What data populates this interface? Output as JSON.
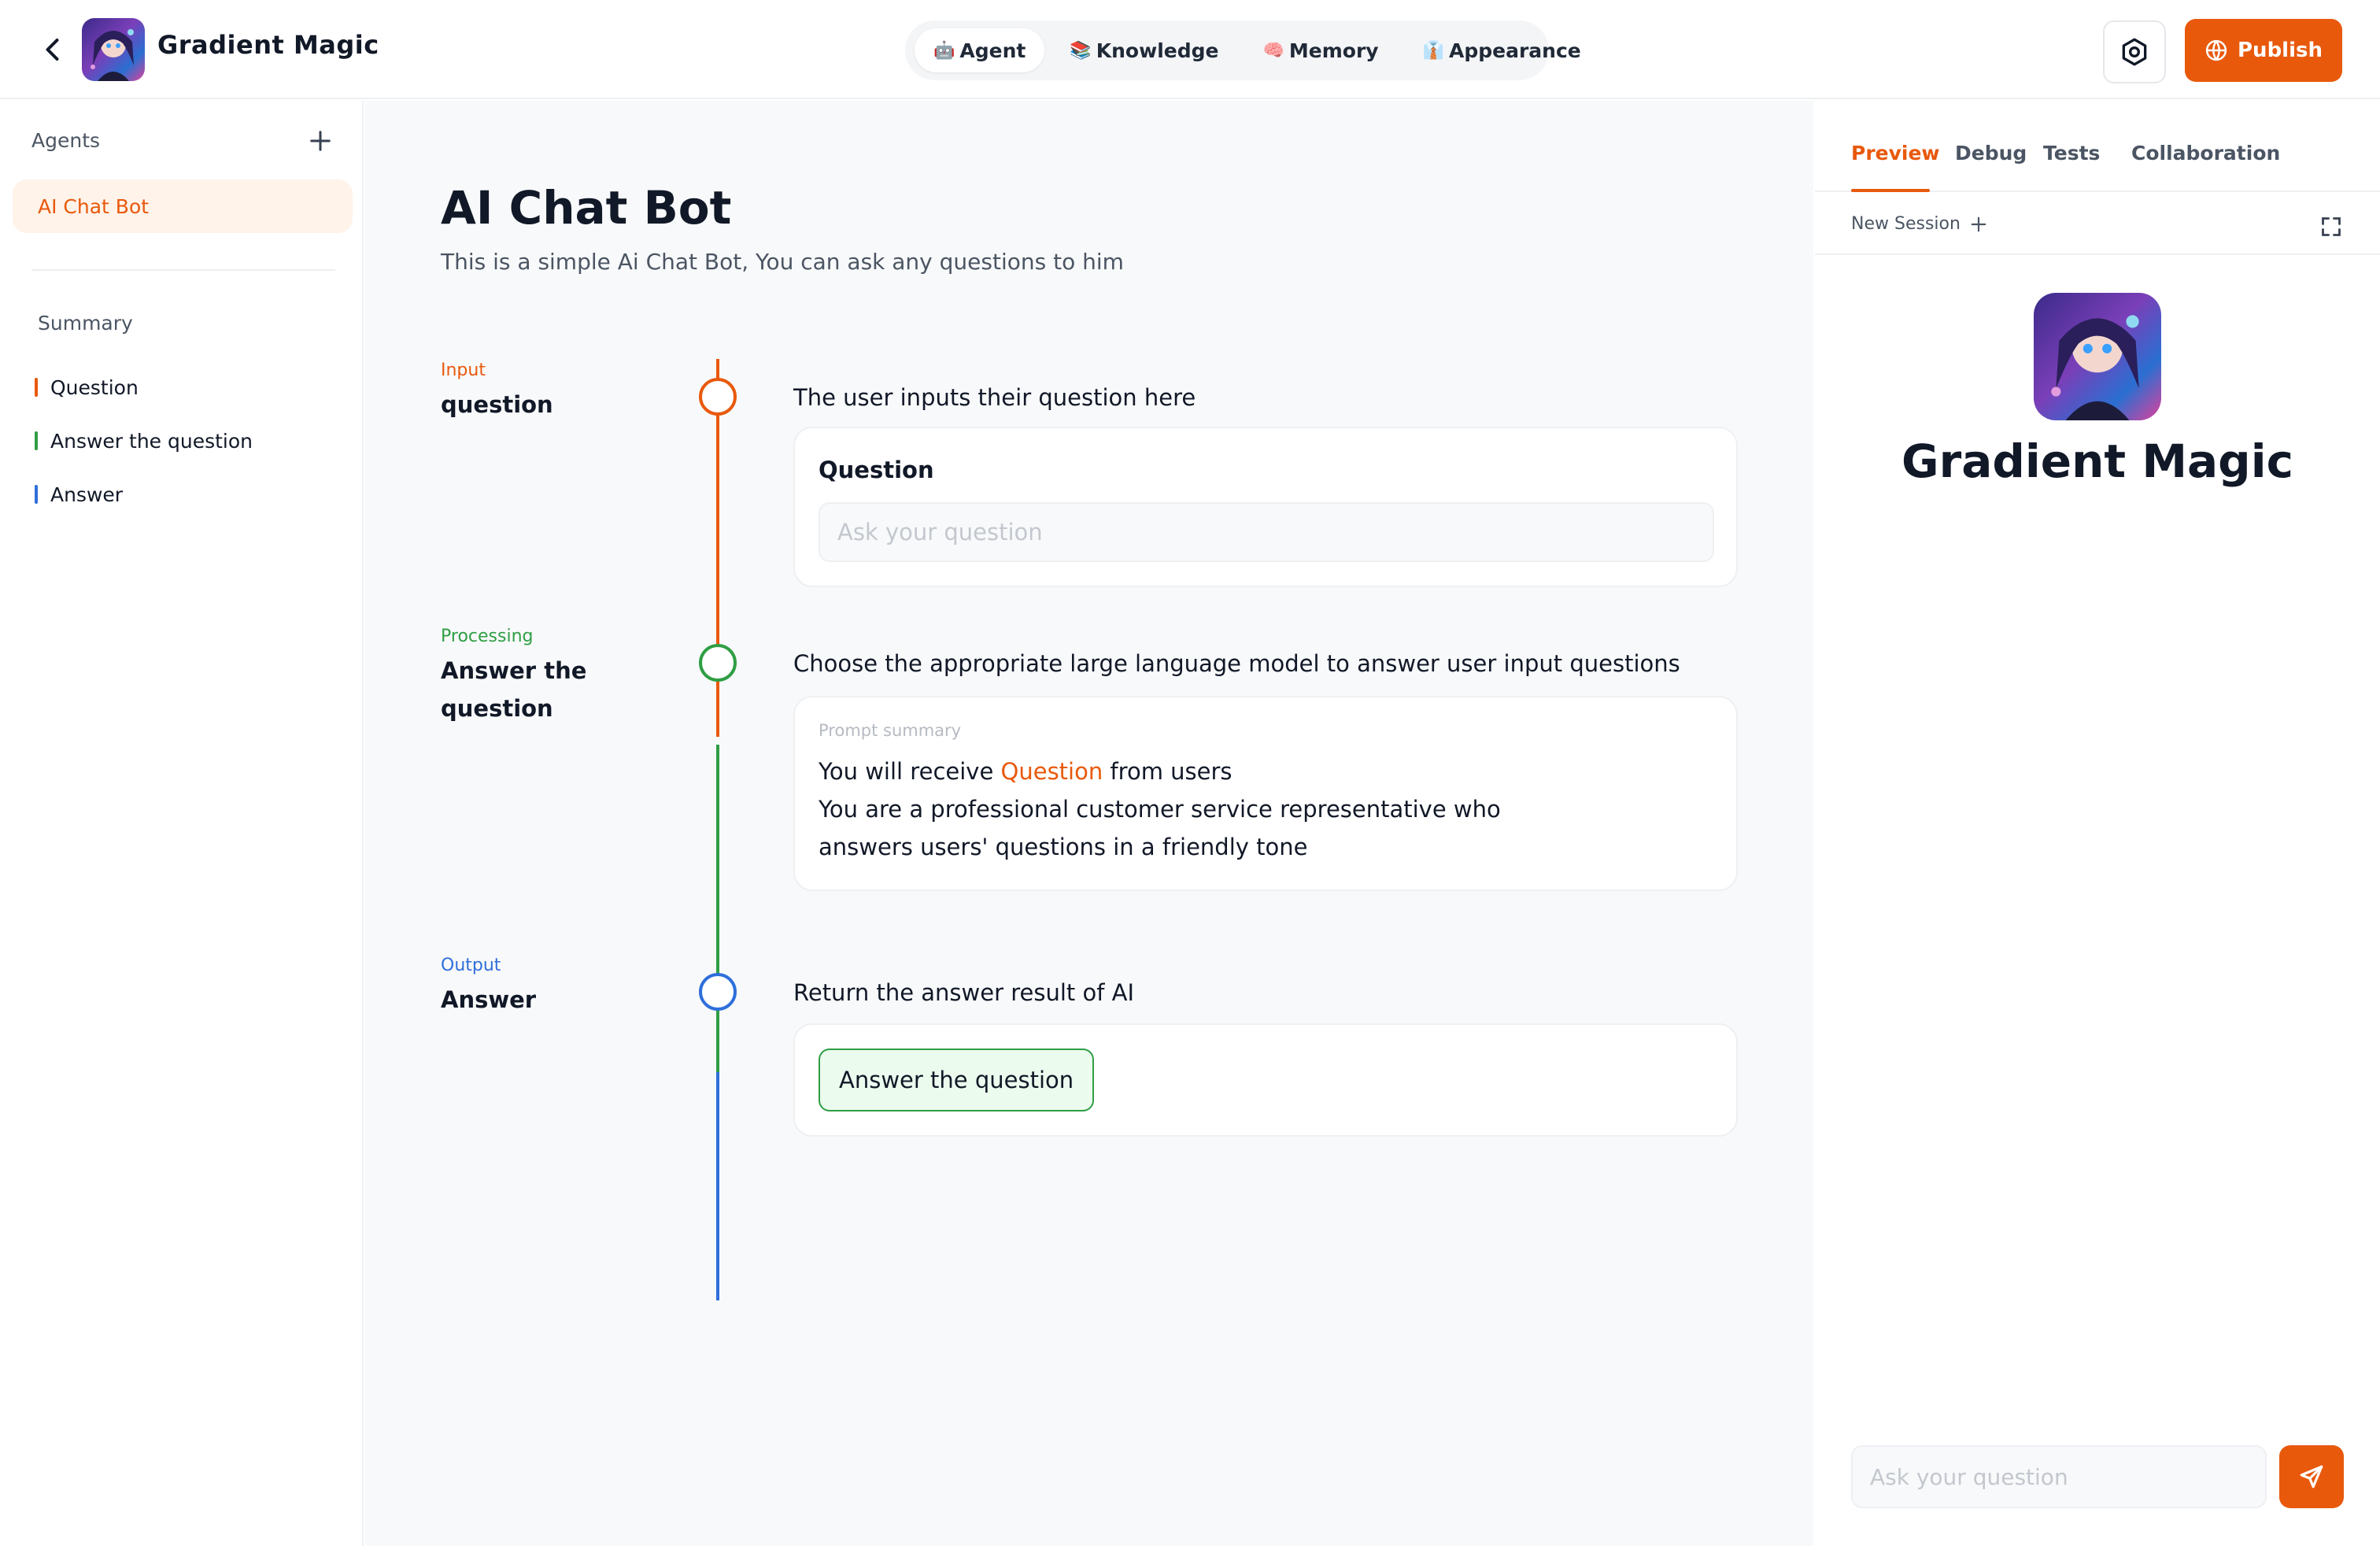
{
  "header": {
    "title": "Gradient Magic",
    "tabs": [
      {
        "label": "Agent",
        "emoji": "🤖",
        "active": true
      },
      {
        "label": "Knowledge",
        "emoji": "📚",
        "active": false
      },
      {
        "label": "Memory",
        "emoji": "🧠",
        "active": false
      },
      {
        "label": "Appearance",
        "emoji": "👔",
        "active": false
      }
    ],
    "publish_label": "Publish"
  },
  "sidebar": {
    "agents_heading": "Agents",
    "agents": [
      {
        "label": "AI Chat Bot",
        "active": true
      }
    ],
    "summary_heading": "Summary",
    "summary_items": [
      {
        "label": "Question",
        "color": "#e8590c"
      },
      {
        "label": "Answer the question",
        "color": "#2f9e44"
      },
      {
        "label": "Answer",
        "color": "#2f6fdb"
      }
    ]
  },
  "main": {
    "title": "AI Chat Bot",
    "description": "This is a simple Ai Chat Bot, You can ask any questions to him",
    "steps": [
      {
        "tag": "Input",
        "name": "question",
        "color": "#e8590c",
        "description": "The user inputs their question here",
        "field_label": "Question",
        "field_placeholder": "Ask your question"
      },
      {
        "tag": "Processing",
        "name": "Answer the question",
        "color": "#2f9e44",
        "description": "Choose the appropriate large language model to answer user input questions",
        "prompt_label": "Prompt summary",
        "prompt_pre": "You will receive ",
        "prompt_highlight": "Question",
        "prompt_post": " from users",
        "prompt_line2": "You are a professional customer service representative who",
        "prompt_line3": "answers users' questions in a friendly tone"
      },
      {
        "tag": "Output",
        "name": "Answer",
        "color": "#2f6fdb",
        "description": "Return the answer result of AI",
        "chip_label": "Answer the question"
      }
    ]
  },
  "right_panel": {
    "tabs": [
      {
        "label": "Preview",
        "active": true
      },
      {
        "label": "Debug",
        "active": false
      },
      {
        "label": "Tests",
        "active": false
      },
      {
        "label": "Collaboration",
        "active": false
      }
    ],
    "new_session_label": "New Session",
    "preview_name": "Gradient Magic",
    "chat_placeholder": "Ask your question"
  },
  "colors": {
    "accent": "#e8590c",
    "processing": "#2f9e44",
    "output": "#2f6fdb"
  },
  "icons": [
    "back-arrow-icon",
    "avatar-image",
    "settings-icon",
    "globe-icon",
    "plus-icon",
    "expand-icon",
    "send-icon"
  ]
}
